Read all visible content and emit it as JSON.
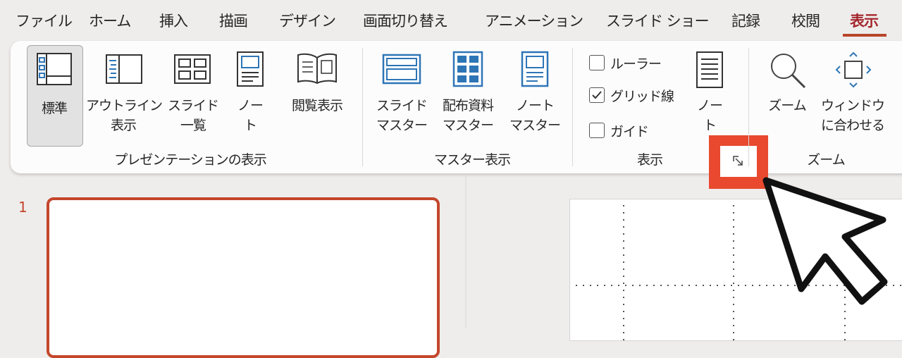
{
  "tabs": [
    {
      "label": "ファイル",
      "active": false
    },
    {
      "label": "ホーム",
      "active": false
    },
    {
      "label": "挿入",
      "active": false
    },
    {
      "label": "描画",
      "active": false
    },
    {
      "label": "デザイン",
      "active": false
    },
    {
      "label": "画面切り替え",
      "active": false
    },
    {
      "label": "アニメーション",
      "active": false
    },
    {
      "label": "スライド ショー",
      "active": false
    },
    {
      "label": "記録",
      "active": false
    },
    {
      "label": "校閲",
      "active": false
    },
    {
      "label": "表示",
      "active": true
    }
  ],
  "ribbon": {
    "presentation_views": {
      "group_label": "プレゼンテーションの表示",
      "normal": "標準",
      "outline_line1": "アウトライン",
      "outline_line2": "表示",
      "sorter_line1": "スライド",
      "sorter_line2": "一覧",
      "notes_line1": "ノー",
      "notes_line2": "ト",
      "reading": "閲覧表示"
    },
    "master_views": {
      "group_label": "マスター表示",
      "slide_master_line1": "スライド",
      "slide_master_line2": "マスター",
      "handout_master_line1": "配布資料",
      "handout_master_line2": "マスター",
      "notes_master_line1": "ノート",
      "notes_master_line2": "マスター"
    },
    "show": {
      "group_label": "表示",
      "ruler": "ルーラー",
      "gridlines": "グリッド線",
      "guides": "ガイド",
      "ruler_checked": false,
      "gridlines_checked": true,
      "guides_checked": false,
      "notes_line1": "ノー",
      "notes_line2": "ト"
    },
    "zoom": {
      "group_label": "ズーム",
      "zoom": "ズーム",
      "fit_line1": "ウィンドウ",
      "fit_line2": "に合わせる"
    }
  },
  "slides_pane": {
    "slide_number": "1"
  },
  "colors": {
    "accent": "#c4462c",
    "highlight": "#e8492f",
    "active_tab": "#a4262c",
    "icon_blue": "#2e75b6"
  }
}
